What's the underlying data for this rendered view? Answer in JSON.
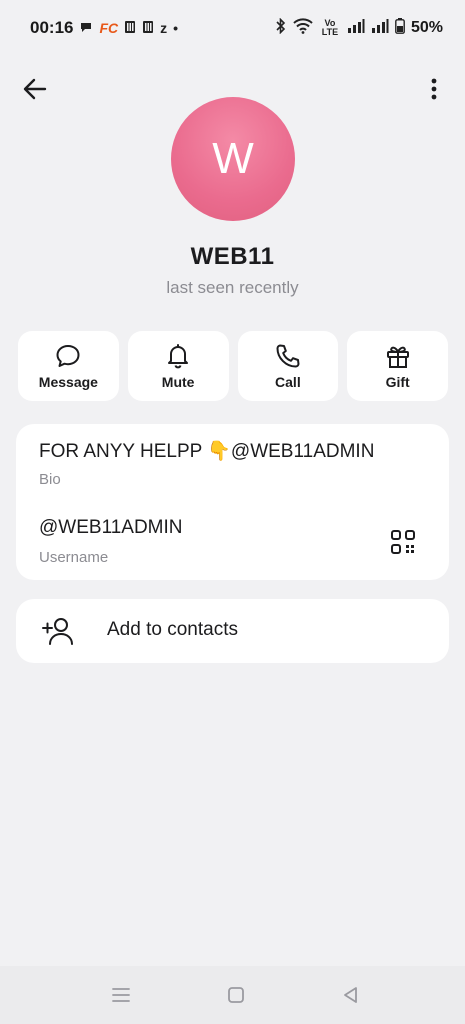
{
  "status_bar": {
    "time": "00:16",
    "indicator_1": "z",
    "indicator_2": "•",
    "network": "Vo LTE",
    "battery": "50%",
    "notif_fc": "FC"
  },
  "profile": {
    "avatar_letter": "W",
    "avatar_color": "#ea6b8e",
    "name": "WEB11",
    "status": "last seen recently"
  },
  "actions": [
    {
      "label": "Message",
      "icon": "message-icon"
    },
    {
      "label": "Mute",
      "icon": "bell-icon"
    },
    {
      "label": "Call",
      "icon": "phone-icon"
    },
    {
      "label": "Gift",
      "icon": "gift-icon"
    }
  ],
  "info": {
    "bio": "FOR ANYY HELPP 👇@WEB11ADMIN",
    "bio_caption": "Bio",
    "username": "@WEB11ADMIN",
    "username_caption": "Username"
  },
  "contact": {
    "label": "Add to contacts"
  }
}
